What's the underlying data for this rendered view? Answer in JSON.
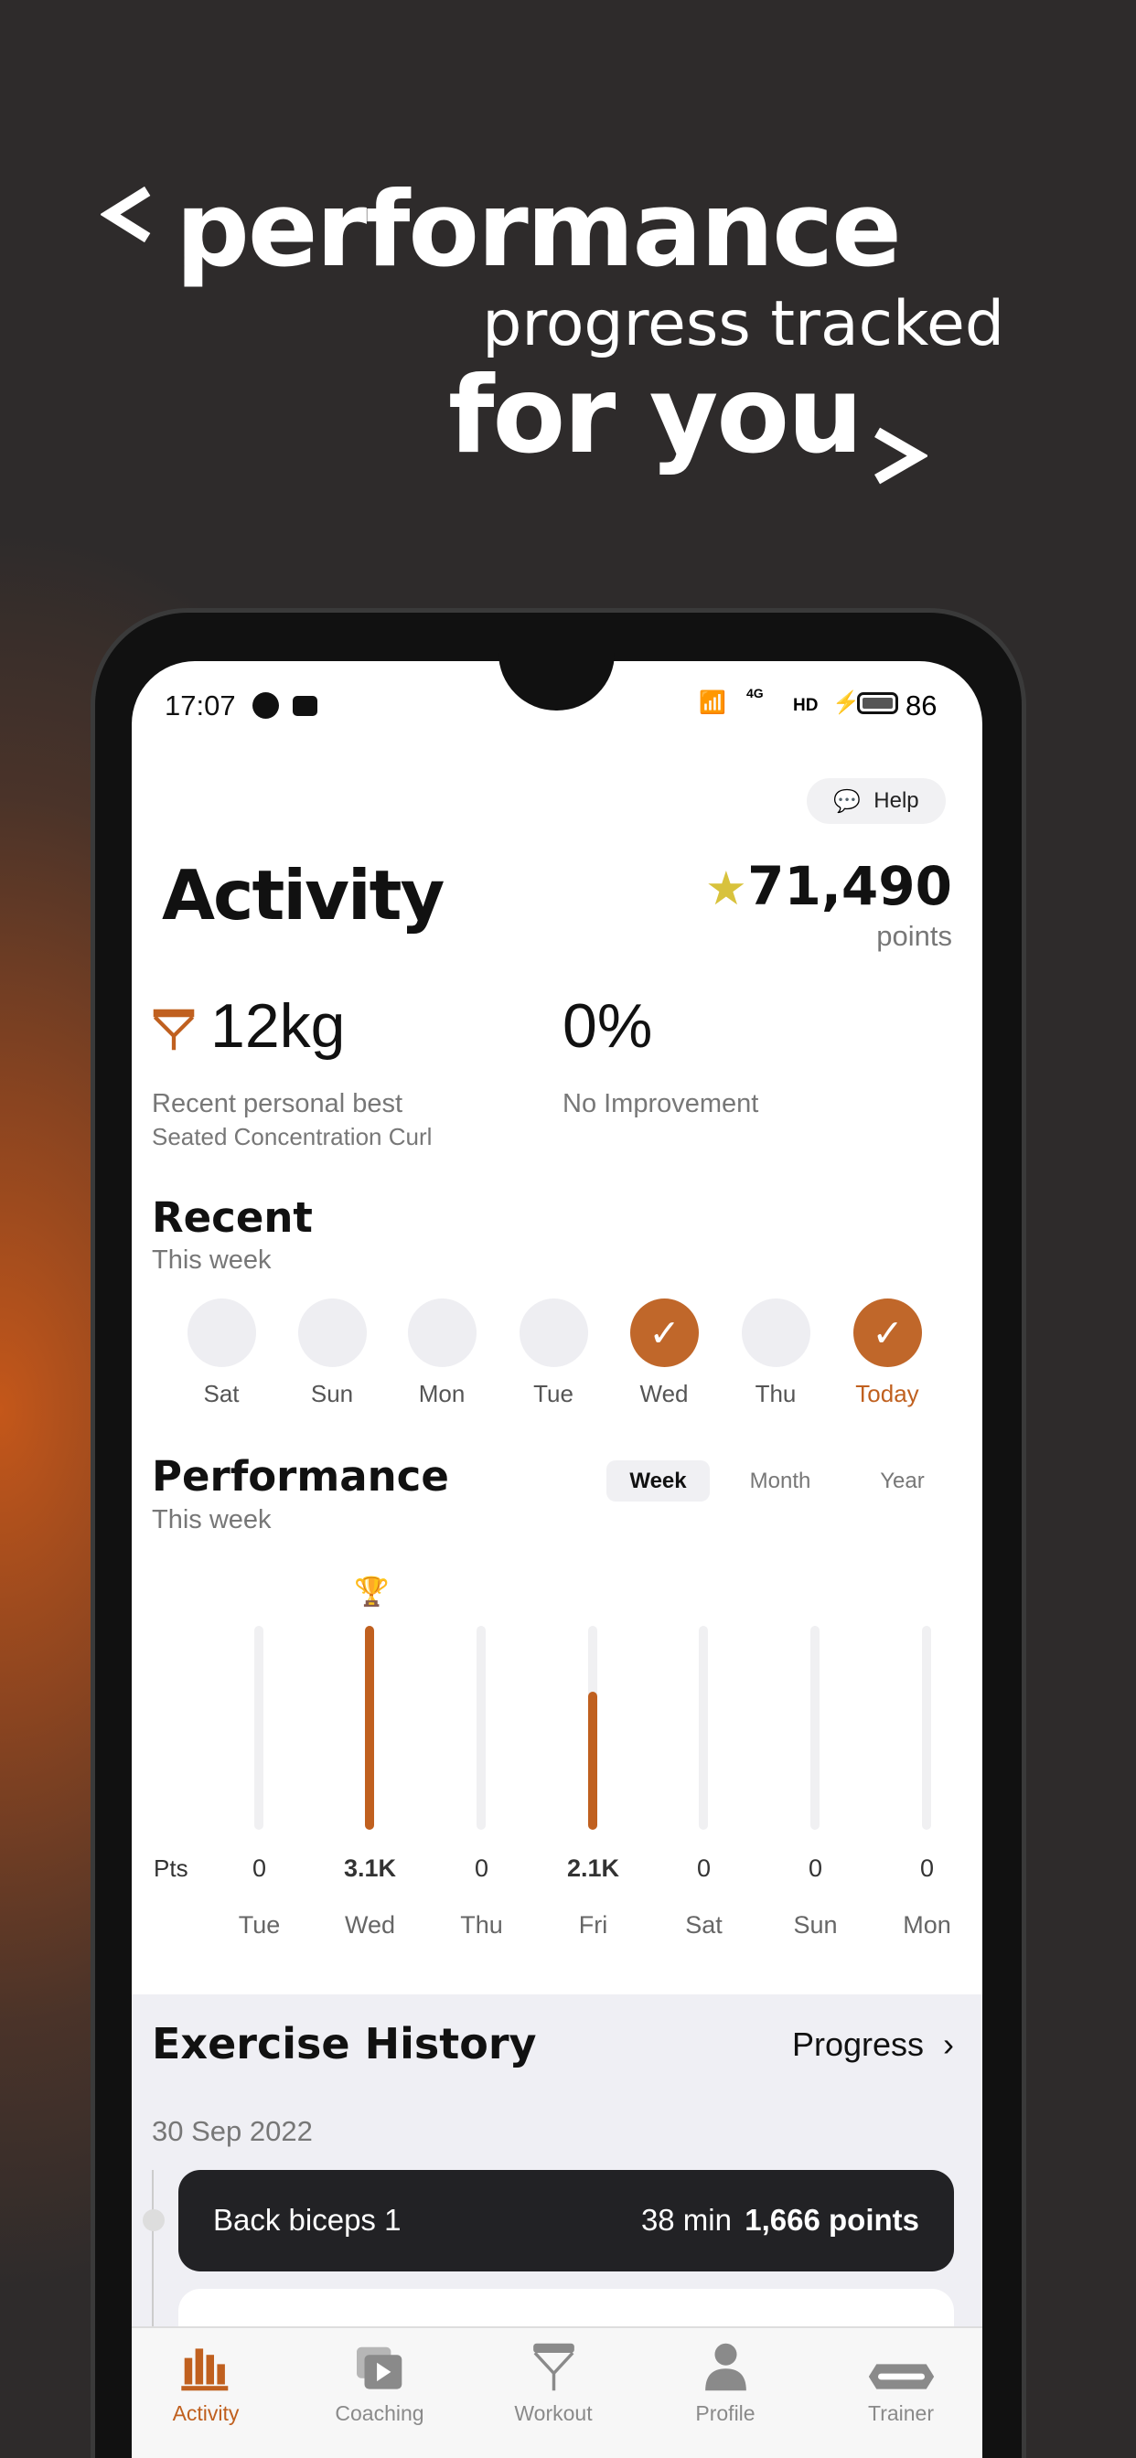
{
  "headline": {
    "line1": "performance",
    "line2": "progress tracked",
    "line3": "for you",
    "prev_icon": "chevron-left",
    "next_icon": "chevron-right"
  },
  "status_bar": {
    "time": "17:07",
    "battery": "86",
    "network": "4G",
    "hd": "HD"
  },
  "help": {
    "label": "Help",
    "icon": "chat-alert-icon"
  },
  "header": {
    "title": "Activity",
    "points_value": "71,490",
    "points_label": "points",
    "star_color": "#d8c23c"
  },
  "stats": [
    {
      "value": "12kg",
      "label": "Recent personal best",
      "sublabel": "Seated Concentration Curl"
    },
    {
      "value": "0%",
      "label": "No Improvement"
    }
  ],
  "recent": {
    "title": "Recent",
    "subtitle": "This week",
    "days": [
      {
        "label": "Sat",
        "done": false
      },
      {
        "label": "Sun",
        "done": false
      },
      {
        "label": "Mon",
        "done": false
      },
      {
        "label": "Tue",
        "done": false
      },
      {
        "label": "Wed",
        "done": true
      },
      {
        "label": "Thu",
        "done": false
      },
      {
        "label": "Today",
        "done": true
      }
    ]
  },
  "performance": {
    "title": "Performance",
    "subtitle": "This week",
    "tabs": [
      "Week",
      "Month",
      "Year"
    ],
    "active_tab": "Week",
    "pts_label": "Pts"
  },
  "chart_data": {
    "type": "bar",
    "categories": [
      "Tue",
      "Wed",
      "Thu",
      "Fri",
      "Sat",
      "Sun",
      "Mon"
    ],
    "values": [
      0,
      3100,
      0,
      2100,
      0,
      0,
      0
    ],
    "value_labels": [
      "0",
      "3.1K",
      "0",
      "2.1K",
      "0",
      "0",
      "0"
    ],
    "ylabel": "Pts",
    "best_marker": "Wed",
    "bar_color": "#c0601f"
  },
  "history": {
    "title": "Exercise History",
    "progress_label": "Progress",
    "date": "30 Sep 2022",
    "items": [
      {
        "name": "Back biceps 1",
        "duration": "38 min",
        "points": "1,666 points"
      }
    ]
  },
  "tabbar": {
    "active": "Activity",
    "accent": "#c0601f",
    "items": [
      {
        "label": "Activity",
        "icon": "bar-chart-icon"
      },
      {
        "label": "Coaching",
        "icon": "video-play-icon"
      },
      {
        "label": "Workout",
        "icon": "resistance-band-icon"
      },
      {
        "label": "Profile",
        "icon": "person-icon"
      },
      {
        "label": "Trainer",
        "icon": "trainer-device-icon"
      }
    ]
  }
}
